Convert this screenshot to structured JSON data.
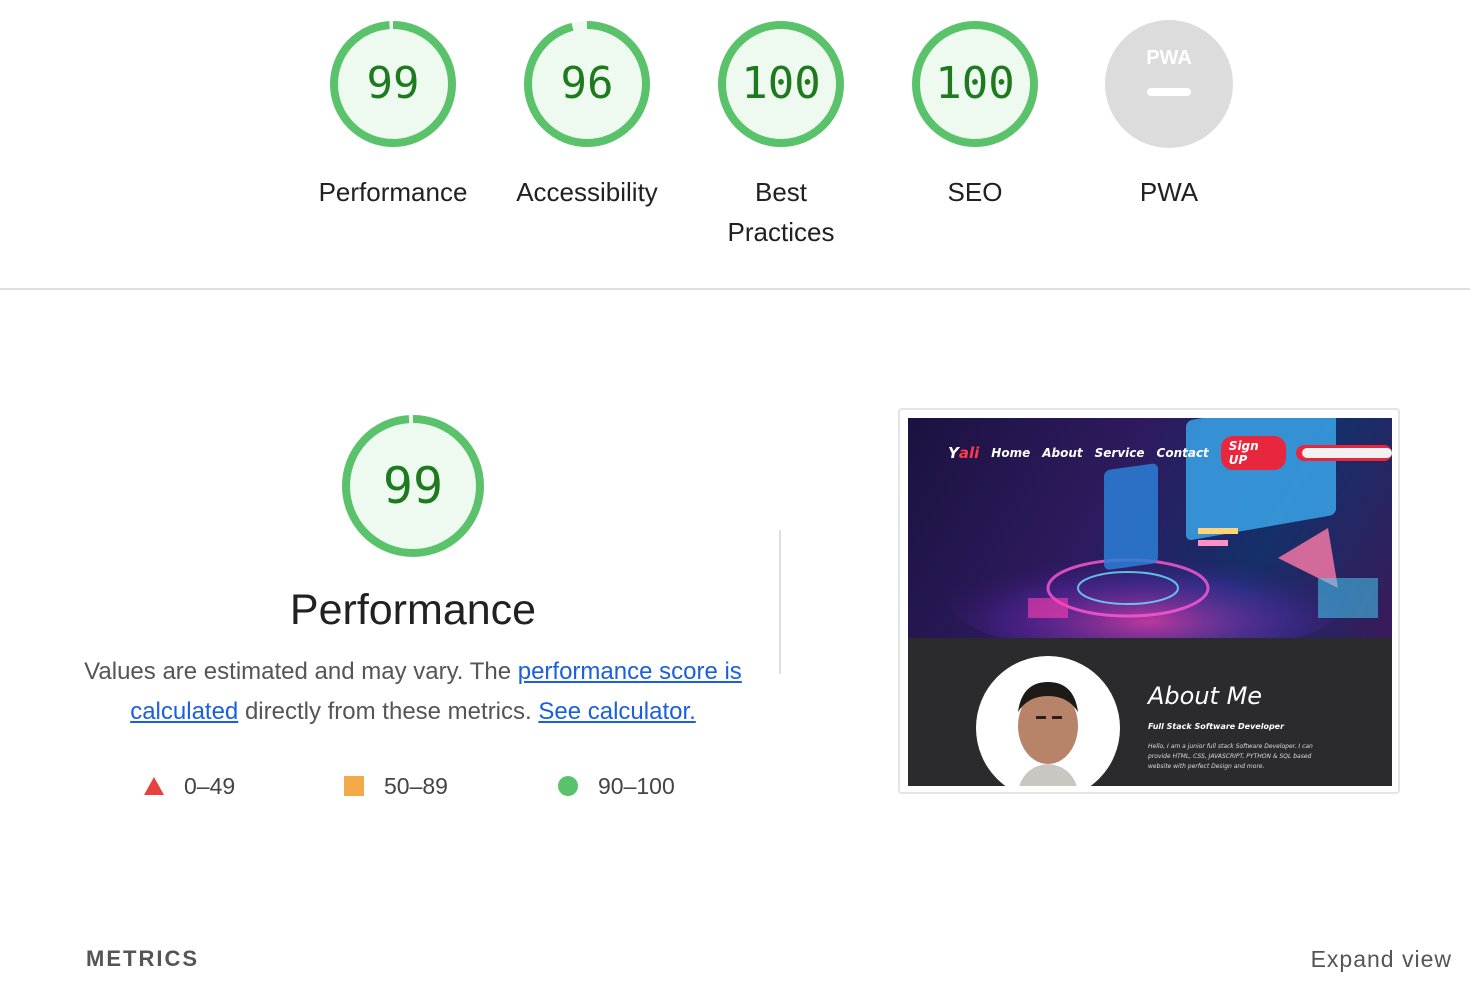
{
  "categories": [
    {
      "label": "Performance",
      "score": "99",
      "fraction": 0.99
    },
    {
      "label": "Accessibility",
      "score": "96",
      "fraction": 0.96
    },
    {
      "label": "Best Practices",
      "score": "100",
      "fraction": 1.0
    },
    {
      "label": "SEO",
      "score": "100",
      "fraction": 1.0
    },
    {
      "label": "PWA",
      "score": "",
      "badge_text": "PWA"
    }
  ],
  "colors": {
    "pass": "#5ac26a",
    "pass_bg": "#eefaf0",
    "pass_text": "#1f7a1f",
    "average": "#f2a947",
    "fail": "#e8403c",
    "link": "#1a5fe0"
  },
  "performance": {
    "score": "99",
    "fraction": 0.99,
    "title": "Performance",
    "desc_part1": "Values are estimated and may vary. The ",
    "link_score": "performance score is calculated",
    "desc_part2": " directly from these metrics. ",
    "link_calc": "See calculator.",
    "legend": {
      "fail": "0–49",
      "average": "50–89",
      "pass": "90–100"
    }
  },
  "screenshot": {
    "brand_y": "Y",
    "brand_ali": "ali",
    "nav": [
      "Home",
      "About",
      "Service",
      "Contact"
    ],
    "signup": "Sign UP",
    "about_title": "About Me",
    "about_sub": "Full Stack Software Developer",
    "about_text": "Hello, I am a junior full stack Software Developer. I can provide HTML, CSS, JAVASCRIPT, PYTHON & SQL based website with perfect Design and more."
  },
  "footer": {
    "metrics": "METRICS",
    "expand": "Expand view"
  }
}
